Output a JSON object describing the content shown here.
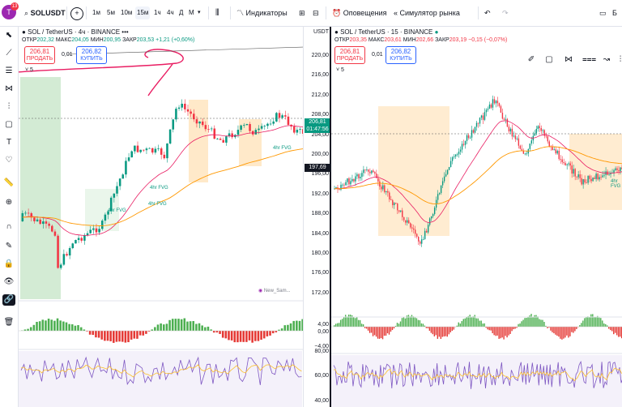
{
  "topbar": {
    "avatar_letter": "T",
    "avatar_badge": "13",
    "symbol": "SOLUSDT",
    "add": "+",
    "intervals": [
      "1м",
      "5м",
      "10м",
      "15м",
      "1ч",
      "4ч",
      "Д",
      "М"
    ],
    "active_interval": "15м",
    "indicators": "Индикаторы",
    "alerts": "Оповещения",
    "replay": "Симулятор рынка",
    "right_cut": "Б"
  },
  "left_chart": {
    "title": "SOL / TetherUS · 4ч · BINANCE",
    "ohlc_labels": {
      "o": "ОТКР",
      "h": "МАКС",
      "l": "МИН",
      "c": "ЗАКР"
    },
    "open": "202,32",
    "high": "204,05",
    "low": "200,95",
    "close": "203,53",
    "change": "+1,21 (+0,60%)",
    "sell_price": "206,81",
    "sell_label": "ПРОДАТЬ",
    "buy_price": "206,82",
    "buy_label": "КУПИТЬ",
    "spread": "0,01",
    "indicators_count": "5",
    "axis_currency": "USDT",
    "ticks": [
      "220,00",
      "216,00",
      "212,00",
      "208,00",
      "204,00",
      "200,00",
      "196,00",
      "192,00",
      "188,00",
      "184,00",
      "180,00",
      "176,00",
      "172,00"
    ],
    "last_price": "206,81",
    "countdown": "01:47:56",
    "price_label": "197,69",
    "osc_ticks": [
      "4,00",
      "0,00",
      "−4,00"
    ],
    "rsi_ticks": [
      "80,00",
      "60,00",
      "40,00"
    ],
    "fvg_labels": [
      "4hr FVG",
      "4hr FVG",
      "4hr FVG",
      "4hr FVG"
    ],
    "news_label": "New_Sam..."
  },
  "right_chart": {
    "title": "SOL / TetherUS · 15 · BINANCE",
    "open": "203,35",
    "high": "203,61",
    "low": "202,66",
    "close": "203,19",
    "change": "−0,15 (−0,07%)",
    "sell_price": "206,81",
    "sell_label": "ПРОДАТЬ",
    "buy_price": "206,82",
    "buy_label": "КУПИТЬ",
    "spread": "0,01",
    "indicators_count": "5",
    "fvg_label": "4hr FVG"
  },
  "colors": {
    "up": "#089981",
    "down": "#f23645",
    "accent": "#2962ff",
    "ema_pink": "#e91e63",
    "ema_orange": "#ff9800",
    "rsi": "#7e57c2"
  }
}
